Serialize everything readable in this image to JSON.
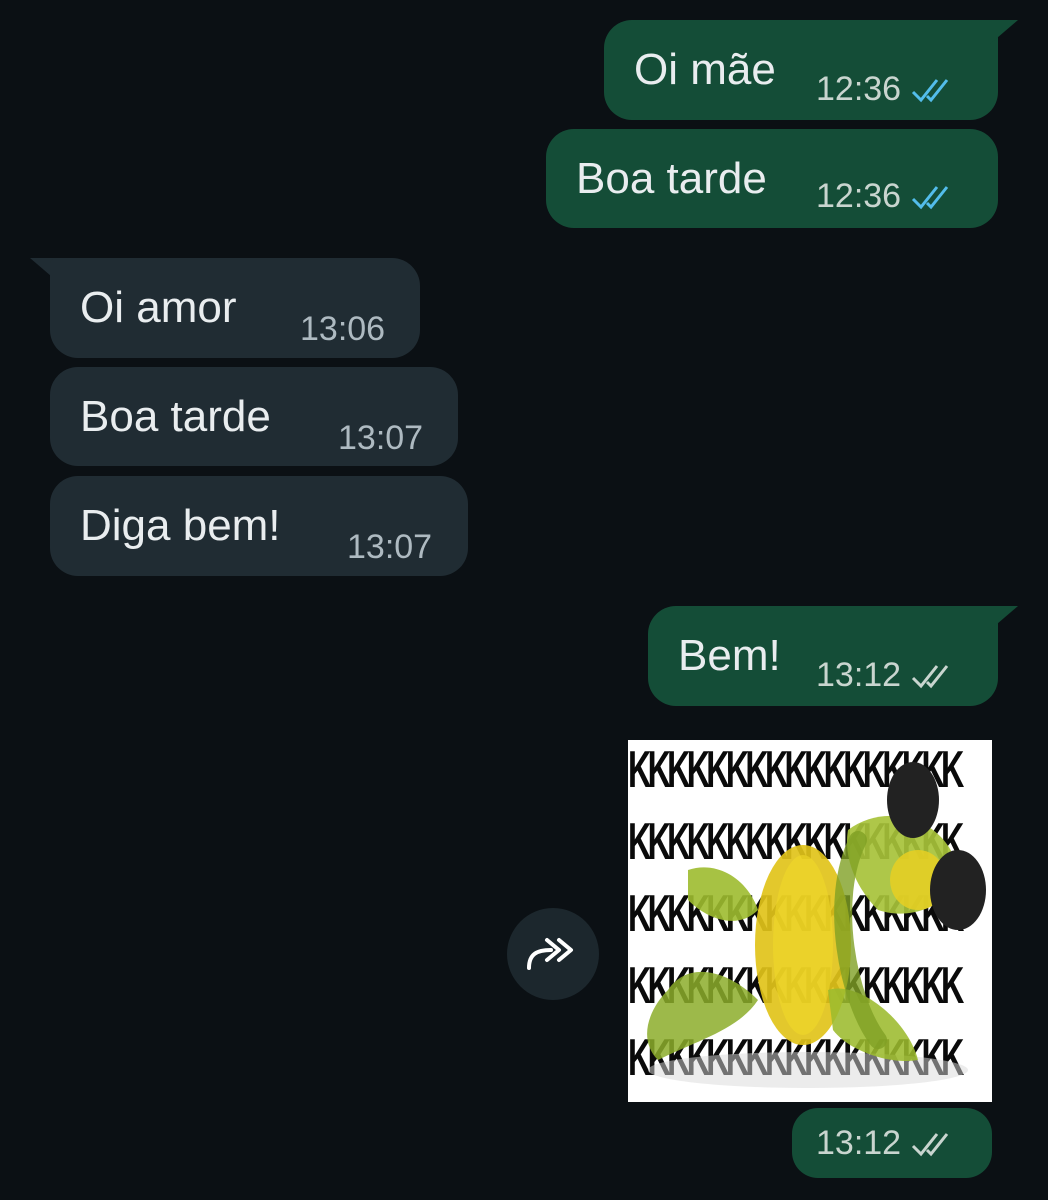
{
  "colors": {
    "background": "#0b1014",
    "outgoing_bubble": "#144d37",
    "incoming_bubble": "#202c33",
    "read_tick": "#53bdeb",
    "delivered_tick": "#c9d5cf"
  },
  "messages": [
    {
      "text": "Oi mãe",
      "time": "12:36",
      "direction": "outgoing",
      "status": "read"
    },
    {
      "text": "Boa tarde",
      "time": "12:36",
      "direction": "outgoing",
      "status": "read"
    },
    {
      "text": "Oi amor",
      "time": "13:06",
      "direction": "incoming"
    },
    {
      "text": "Boa tarde",
      "time": "13:07",
      "direction": "incoming"
    },
    {
      "text": "Diga bem!",
      "time": "13:07",
      "direction": "incoming"
    },
    {
      "text": "Bem!",
      "time": "13:12",
      "direction": "outgoing",
      "status": "delivered"
    }
  ],
  "sticker": {
    "text_rows": [
      "KKKKKKKKKKKKKKKKK",
      "KKKKKKKKKKKKKKKKK",
      "KKKKKKKKKKKKKKKKK",
      "KKKKKKKKKKKKKKKKK",
      "KKKKKKKKKKKKKKKKK"
    ],
    "time": "13:12",
    "status": "delivered",
    "icon": "frog-sticker-icon"
  },
  "forward_button": {
    "icon": "forward-icon"
  }
}
